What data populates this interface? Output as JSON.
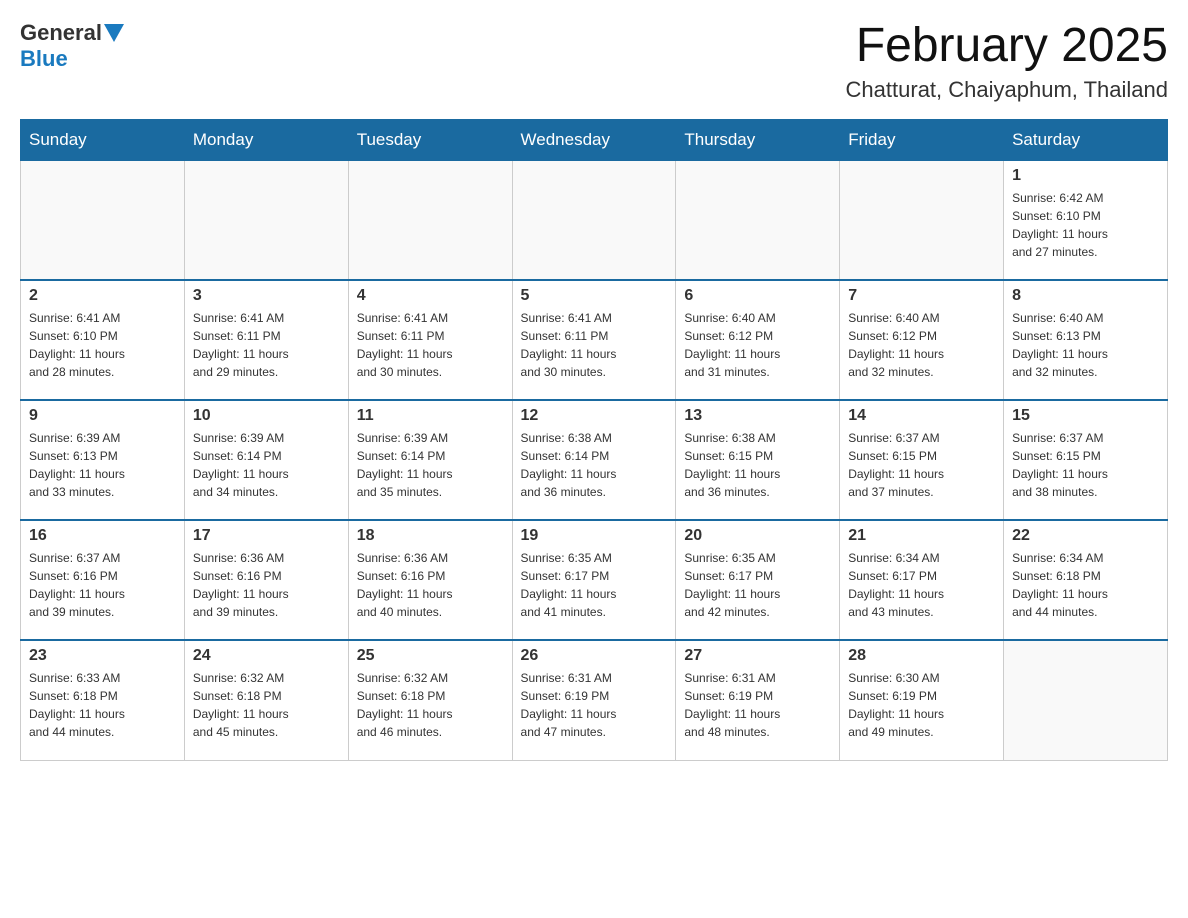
{
  "header": {
    "logo": {
      "general": "General",
      "blue": "Blue"
    },
    "title": "February 2025",
    "location": "Chatturat, Chaiyaphum, Thailand"
  },
  "days_of_week": [
    "Sunday",
    "Monday",
    "Tuesday",
    "Wednesday",
    "Thursday",
    "Friday",
    "Saturday"
  ],
  "weeks": [
    [
      {
        "day": "",
        "info": ""
      },
      {
        "day": "",
        "info": ""
      },
      {
        "day": "",
        "info": ""
      },
      {
        "day": "",
        "info": ""
      },
      {
        "day": "",
        "info": ""
      },
      {
        "day": "",
        "info": ""
      },
      {
        "day": "1",
        "info": "Sunrise: 6:42 AM\nSunset: 6:10 PM\nDaylight: 11 hours\nand 27 minutes."
      }
    ],
    [
      {
        "day": "2",
        "info": "Sunrise: 6:41 AM\nSunset: 6:10 PM\nDaylight: 11 hours\nand 28 minutes."
      },
      {
        "day": "3",
        "info": "Sunrise: 6:41 AM\nSunset: 6:11 PM\nDaylight: 11 hours\nand 29 minutes."
      },
      {
        "day": "4",
        "info": "Sunrise: 6:41 AM\nSunset: 6:11 PM\nDaylight: 11 hours\nand 30 minutes."
      },
      {
        "day": "5",
        "info": "Sunrise: 6:41 AM\nSunset: 6:11 PM\nDaylight: 11 hours\nand 30 minutes."
      },
      {
        "day": "6",
        "info": "Sunrise: 6:40 AM\nSunset: 6:12 PM\nDaylight: 11 hours\nand 31 minutes."
      },
      {
        "day": "7",
        "info": "Sunrise: 6:40 AM\nSunset: 6:12 PM\nDaylight: 11 hours\nand 32 minutes."
      },
      {
        "day": "8",
        "info": "Sunrise: 6:40 AM\nSunset: 6:13 PM\nDaylight: 11 hours\nand 32 minutes."
      }
    ],
    [
      {
        "day": "9",
        "info": "Sunrise: 6:39 AM\nSunset: 6:13 PM\nDaylight: 11 hours\nand 33 minutes."
      },
      {
        "day": "10",
        "info": "Sunrise: 6:39 AM\nSunset: 6:14 PM\nDaylight: 11 hours\nand 34 minutes."
      },
      {
        "day": "11",
        "info": "Sunrise: 6:39 AM\nSunset: 6:14 PM\nDaylight: 11 hours\nand 35 minutes."
      },
      {
        "day": "12",
        "info": "Sunrise: 6:38 AM\nSunset: 6:14 PM\nDaylight: 11 hours\nand 36 minutes."
      },
      {
        "day": "13",
        "info": "Sunrise: 6:38 AM\nSunset: 6:15 PM\nDaylight: 11 hours\nand 36 minutes."
      },
      {
        "day": "14",
        "info": "Sunrise: 6:37 AM\nSunset: 6:15 PM\nDaylight: 11 hours\nand 37 minutes."
      },
      {
        "day": "15",
        "info": "Sunrise: 6:37 AM\nSunset: 6:15 PM\nDaylight: 11 hours\nand 38 minutes."
      }
    ],
    [
      {
        "day": "16",
        "info": "Sunrise: 6:37 AM\nSunset: 6:16 PM\nDaylight: 11 hours\nand 39 minutes."
      },
      {
        "day": "17",
        "info": "Sunrise: 6:36 AM\nSunset: 6:16 PM\nDaylight: 11 hours\nand 39 minutes."
      },
      {
        "day": "18",
        "info": "Sunrise: 6:36 AM\nSunset: 6:16 PM\nDaylight: 11 hours\nand 40 minutes."
      },
      {
        "day": "19",
        "info": "Sunrise: 6:35 AM\nSunset: 6:17 PM\nDaylight: 11 hours\nand 41 minutes."
      },
      {
        "day": "20",
        "info": "Sunrise: 6:35 AM\nSunset: 6:17 PM\nDaylight: 11 hours\nand 42 minutes."
      },
      {
        "day": "21",
        "info": "Sunrise: 6:34 AM\nSunset: 6:17 PM\nDaylight: 11 hours\nand 43 minutes."
      },
      {
        "day": "22",
        "info": "Sunrise: 6:34 AM\nSunset: 6:18 PM\nDaylight: 11 hours\nand 44 minutes."
      }
    ],
    [
      {
        "day": "23",
        "info": "Sunrise: 6:33 AM\nSunset: 6:18 PM\nDaylight: 11 hours\nand 44 minutes."
      },
      {
        "day": "24",
        "info": "Sunrise: 6:32 AM\nSunset: 6:18 PM\nDaylight: 11 hours\nand 45 minutes."
      },
      {
        "day": "25",
        "info": "Sunrise: 6:32 AM\nSunset: 6:18 PM\nDaylight: 11 hours\nand 46 minutes."
      },
      {
        "day": "26",
        "info": "Sunrise: 6:31 AM\nSunset: 6:19 PM\nDaylight: 11 hours\nand 47 minutes."
      },
      {
        "day": "27",
        "info": "Sunrise: 6:31 AM\nSunset: 6:19 PM\nDaylight: 11 hours\nand 48 minutes."
      },
      {
        "day": "28",
        "info": "Sunrise: 6:30 AM\nSunset: 6:19 PM\nDaylight: 11 hours\nand 49 minutes."
      },
      {
        "day": "",
        "info": ""
      }
    ]
  ]
}
